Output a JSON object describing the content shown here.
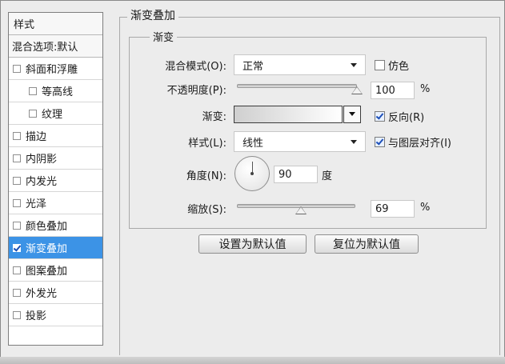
{
  "sidebar": {
    "items": [
      {
        "label": "样式",
        "type": "header",
        "checked": false
      },
      {
        "label": "混合选项:默认",
        "type": "header",
        "checked": false
      },
      {
        "label": "斜面和浮雕",
        "type": "checkbox",
        "checked": false
      },
      {
        "label": "等高线",
        "type": "sub",
        "checked": false
      },
      {
        "label": "纹理",
        "type": "sub",
        "checked": false
      },
      {
        "label": "描边",
        "type": "checkbox",
        "checked": false
      },
      {
        "label": "内阴影",
        "type": "checkbox",
        "checked": false
      },
      {
        "label": "内发光",
        "type": "checkbox",
        "checked": false
      },
      {
        "label": "光泽",
        "type": "checkbox",
        "checked": false
      },
      {
        "label": "颜色叠加",
        "type": "checkbox",
        "checked": false
      },
      {
        "label": "渐变叠加",
        "type": "checkbox",
        "checked": true,
        "selected": true
      },
      {
        "label": "图案叠加",
        "type": "checkbox",
        "checked": false
      },
      {
        "label": "外发光",
        "type": "checkbox",
        "checked": false
      },
      {
        "label": "投影",
        "type": "checkbox",
        "checked": false
      }
    ]
  },
  "panel": {
    "group_title": "渐变叠加",
    "subgroup_title": "渐变",
    "blend_mode": {
      "label": "混合模式(O):",
      "value": "正常"
    },
    "dither": {
      "label": "仿色",
      "checked": false
    },
    "opacity": {
      "label": "不透明度(P):",
      "value": "100",
      "unit": "%",
      "level_percent": 100
    },
    "gradient": {
      "label": "渐变:",
      "colors": [
        "#cfcfcf",
        "#ffffff"
      ]
    },
    "reverse": {
      "label": "反向(R)",
      "checked": true
    },
    "style": {
      "label": "样式(L):",
      "value": "线性"
    },
    "align_layer": {
      "label": "与图层对齐(I)",
      "checked": true
    },
    "angle": {
      "label": "角度(N):",
      "value": "90",
      "unit": "度"
    },
    "scale": {
      "label": "缩放(S):",
      "value": "69",
      "unit": "%",
      "level_percent": 69
    }
  },
  "buttons": {
    "make_default": "设置为默认值",
    "reset_default": "复位为默认值"
  },
  "colors": {
    "selection": "#3c93e6",
    "panel_bg": "#ececec"
  }
}
